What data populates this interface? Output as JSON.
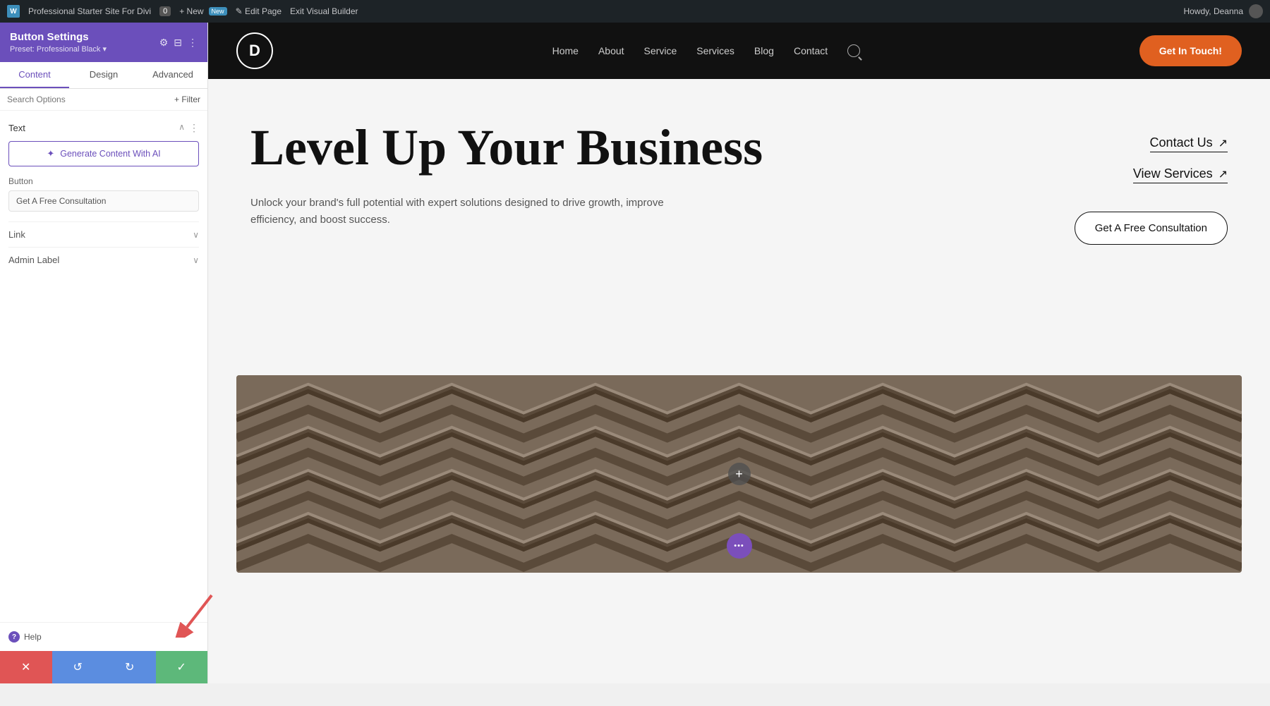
{
  "adminBar": {
    "wpLabel": "W",
    "siteName": "Professional Starter Site For Divi",
    "commentCount": "0",
    "newLabel": "+ New",
    "newBadge": "New",
    "editPageLabel": "✎ Edit Page",
    "exitBuilderLabel": "Exit Visual Builder",
    "howdyLabel": "Howdy, Deanna"
  },
  "sidebar": {
    "title": "Button Settings",
    "preset": "Preset: Professional Black ▾",
    "tabs": [
      "Content",
      "Design",
      "Advanced"
    ],
    "activeTab": "Content",
    "searchPlaceholder": "Search Options",
    "filterLabel": "+ Filter",
    "textSection": {
      "title": "Text",
      "aiButtonLabel": "Generate Content With AI",
      "aiIcon": "✦"
    },
    "buttonSection": {
      "label": "Button",
      "value": "Get A Free Consultation"
    },
    "linkSection": {
      "label": "Link"
    },
    "adminLabelSection": {
      "label": "Admin Label"
    },
    "helpLabel": "Help"
  },
  "bottomActions": {
    "cancel": "✕",
    "undo": "↺",
    "redo": "↻",
    "save": "✓"
  },
  "siteHeader": {
    "logoLetter": "D",
    "navItems": [
      "Home",
      "About",
      "Service",
      "Services",
      "Blog",
      "Contact"
    ],
    "ctaButton": "Get In Touch!",
    "searchAriaLabel": "search"
  },
  "hero": {
    "title": "Level Up Your Business",
    "subtitle": "Unlock your brand's full potential with expert solutions designed to drive growth, improve efficiency, and boost success.",
    "contactUsLabel": "Contact Us",
    "viewServicesLabel": "View Services",
    "consultationLabel": "Get A Free Consultation"
  },
  "image": {
    "addIcon": "+",
    "moreIcon": "•••"
  }
}
